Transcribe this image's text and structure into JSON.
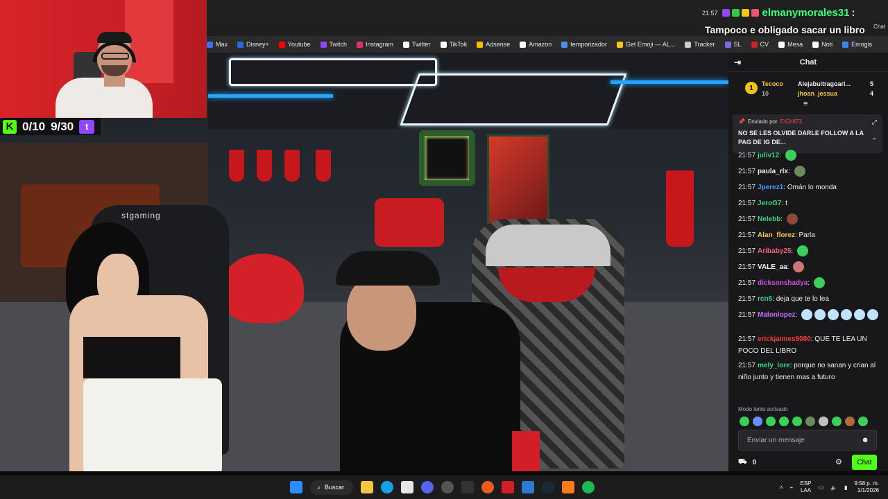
{
  "bookmarks": [
    {
      "label": "Max",
      "color": "#3b6fff"
    },
    {
      "label": "Disney+",
      "color": "#1f6fdc"
    },
    {
      "label": "Youtube",
      "color": "#ff0000"
    },
    {
      "label": "Twitch",
      "color": "#9146ff"
    },
    {
      "label": "Instagram",
      "color": "#e1306c"
    },
    {
      "label": "Twitter",
      "color": "#ffffff"
    },
    {
      "label": "TikTok",
      "color": "#ffffff"
    },
    {
      "label": "Adsense",
      "color": "#fbbc04"
    },
    {
      "label": "Amazon",
      "color": "#ffffff"
    },
    {
      "label": "temporizador",
      "color": "#4a90e2"
    },
    {
      "label": "Get Emoji — AL...",
      "color": "#f5c518"
    },
    {
      "label": "Tracker",
      "color": "#cccccc"
    },
    {
      "label": "SL",
      "color": "#7b68ee"
    },
    {
      "label": "CV",
      "color": "#d21e26"
    },
    {
      "label": "Mesa",
      "color": "#ffffff"
    },
    {
      "label": "Noti",
      "color": "#ffffff"
    },
    {
      "label": "Emogis",
      "color": "#3b82f6"
    }
  ],
  "overlay": {
    "time": "21:57",
    "user": "elmanymorales31",
    "colon": ":",
    "message": "Tampoco e obligado sacar un libro",
    "chat_label": "Chat"
  },
  "counter": {
    "kick_logo": "K",
    "kick_count": "0/10",
    "twitch_count": "9/30",
    "twitch_logo": "t"
  },
  "scene": {
    "chair_brand": "stgaming"
  },
  "chat": {
    "title": "Chat",
    "leaderboard": {
      "rank_badge": "1",
      "first_user": "Tecoco",
      "first_points": "10",
      "second_user": "Alejabuitragoari...",
      "second_points": "5",
      "third_user": "jhoan_jessua",
      "third_points": "4"
    },
    "pinned": {
      "by_label": "Enviado por",
      "by_user": "EICh873",
      "message": "NO SE LES OLVIDE DARLE FOLLOW A LA PAG DE IG DE..."
    },
    "messages": [
      {
        "time": "21:57",
        "user": "juliv12",
        "color": "#39d97b",
        "text": ""
      },
      {
        "time": "21:57",
        "user": "paula_rlx",
        "color": "#efeff1",
        "text": ""
      },
      {
        "time": "21:57",
        "user": "Jperez1",
        "color": "#4d9bff",
        "text": "Omán lo monda"
      },
      {
        "time": "21:57",
        "user": "JeroG7",
        "color": "#39d97b",
        "text": "t"
      },
      {
        "time": "21:57",
        "user": "Nelebb",
        "color": "#39d97b",
        "text": ""
      },
      {
        "time": "21:57",
        "user": "Alan_florez",
        "color": "#f5c542",
        "text": "Parla"
      },
      {
        "time": "21:57",
        "user": "Aribaby25",
        "color": "#ff5c7a",
        "text": ""
      },
      {
        "time": "21:57",
        "user": "VALE_aa",
        "color": "#efeff1",
        "text": ""
      },
      {
        "time": "21:57",
        "user": "dicksonshadya",
        "color": "#d24de0",
        "text": ""
      },
      {
        "time": "21:57",
        "user": "rcn5",
        "color": "#39d97b",
        "text": "deja que te lo lea"
      },
      {
        "time": "21:57",
        "user": "Malonlopez",
        "color": "#c06bff",
        "text": ""
      },
      {
        "time": "21:57",
        "user": "erickjaimes9080",
        "color": "#ff3b3b",
        "text": "QUE TE LEA UN POCO DEL LIBRO"
      },
      {
        "time": "21:57",
        "user": "mely_lore",
        "color": "#39d97b",
        "text": "porque no sanan y crian al niño junto y tienen mas a futuro"
      }
    ],
    "slow_mode": "Modo lento activado",
    "input_placeholder": "Enviar un mensaje",
    "points": "0",
    "send_label": "Chat"
  },
  "taskbar": {
    "search_label": "Buscar",
    "lang_line1": "ESP",
    "lang_line2": "LAA",
    "time": "9:58 p. m.",
    "date": "1/1/2026"
  }
}
